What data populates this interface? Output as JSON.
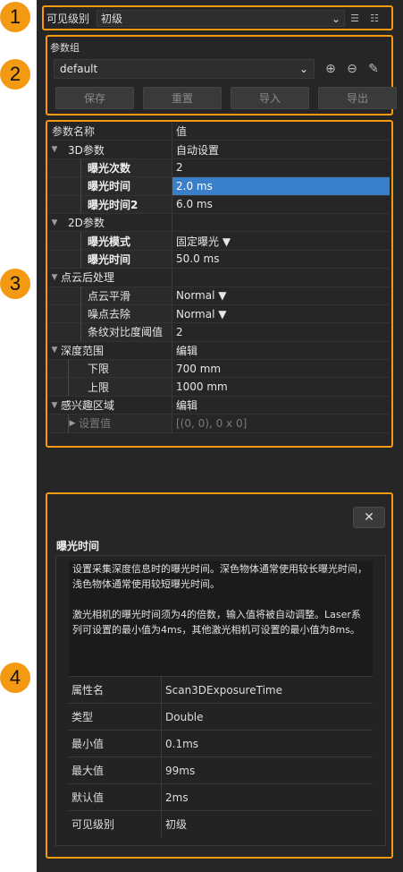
{
  "callouts": [
    "1",
    "2",
    "3",
    "4"
  ],
  "visibility": {
    "label": "可见级别",
    "selected": "初级"
  },
  "param_group": {
    "title": "参数组",
    "selected": "default",
    "buttons": {
      "save": "保存",
      "reset": "重置",
      "import": "导入",
      "export": "导出"
    }
  },
  "tree": {
    "header": {
      "name": "参数名称",
      "value": "值"
    },
    "rows": [
      {
        "name": "3D参数",
        "value": "自动设置"
      },
      {
        "name": "曝光次数",
        "value": "2"
      },
      {
        "name": "曝光时间",
        "value": "2.0 ms"
      },
      {
        "name": "曝光时间2",
        "value": "6.0 ms"
      },
      {
        "name": "2D参数",
        "value": ""
      },
      {
        "name": "曝光模式",
        "value": "固定曝光 ▼"
      },
      {
        "name": "曝光时间",
        "value": "50.0 ms"
      },
      {
        "name": "点云后处理",
        "value": ""
      },
      {
        "name": "点云平滑",
        "value": "Normal ▼"
      },
      {
        "name": "噪点去除",
        "value": "Normal ▼"
      },
      {
        "name": "条纹对比度阈值",
        "value": "2"
      },
      {
        "name": "深度范围",
        "value": "编辑"
      },
      {
        "name": "下限",
        "value": "700 mm"
      },
      {
        "name": "上限",
        "value": "1000 mm"
      },
      {
        "name": "感兴趣区域",
        "value": "编辑"
      },
      {
        "name": "设置值",
        "value": "[(0, 0), 0 x 0]"
      }
    ]
  },
  "help": {
    "title": "曝光时间",
    "para1": "设置采集深度信息时的曝光时间。深色物体通常使用较长曝光时间，浅色物体通常使用较短曝光时间。",
    "para2": "激光相机的曝光时间须为4的倍数，输入值将被自动调整。Laser系列可设置的最小值为4ms，其他激光相机可设置的最小值为8ms。",
    "props": [
      {
        "k": "属性名",
        "v": "Scan3DExposureTime"
      },
      {
        "k": "类型",
        "v": "Double"
      },
      {
        "k": "最小值",
        "v": "0.1ms"
      },
      {
        "k": "最大值",
        "v": "99ms"
      },
      {
        "k": "默认值",
        "v": "2ms"
      },
      {
        "k": "可见级别",
        "v": "初级"
      }
    ]
  }
}
